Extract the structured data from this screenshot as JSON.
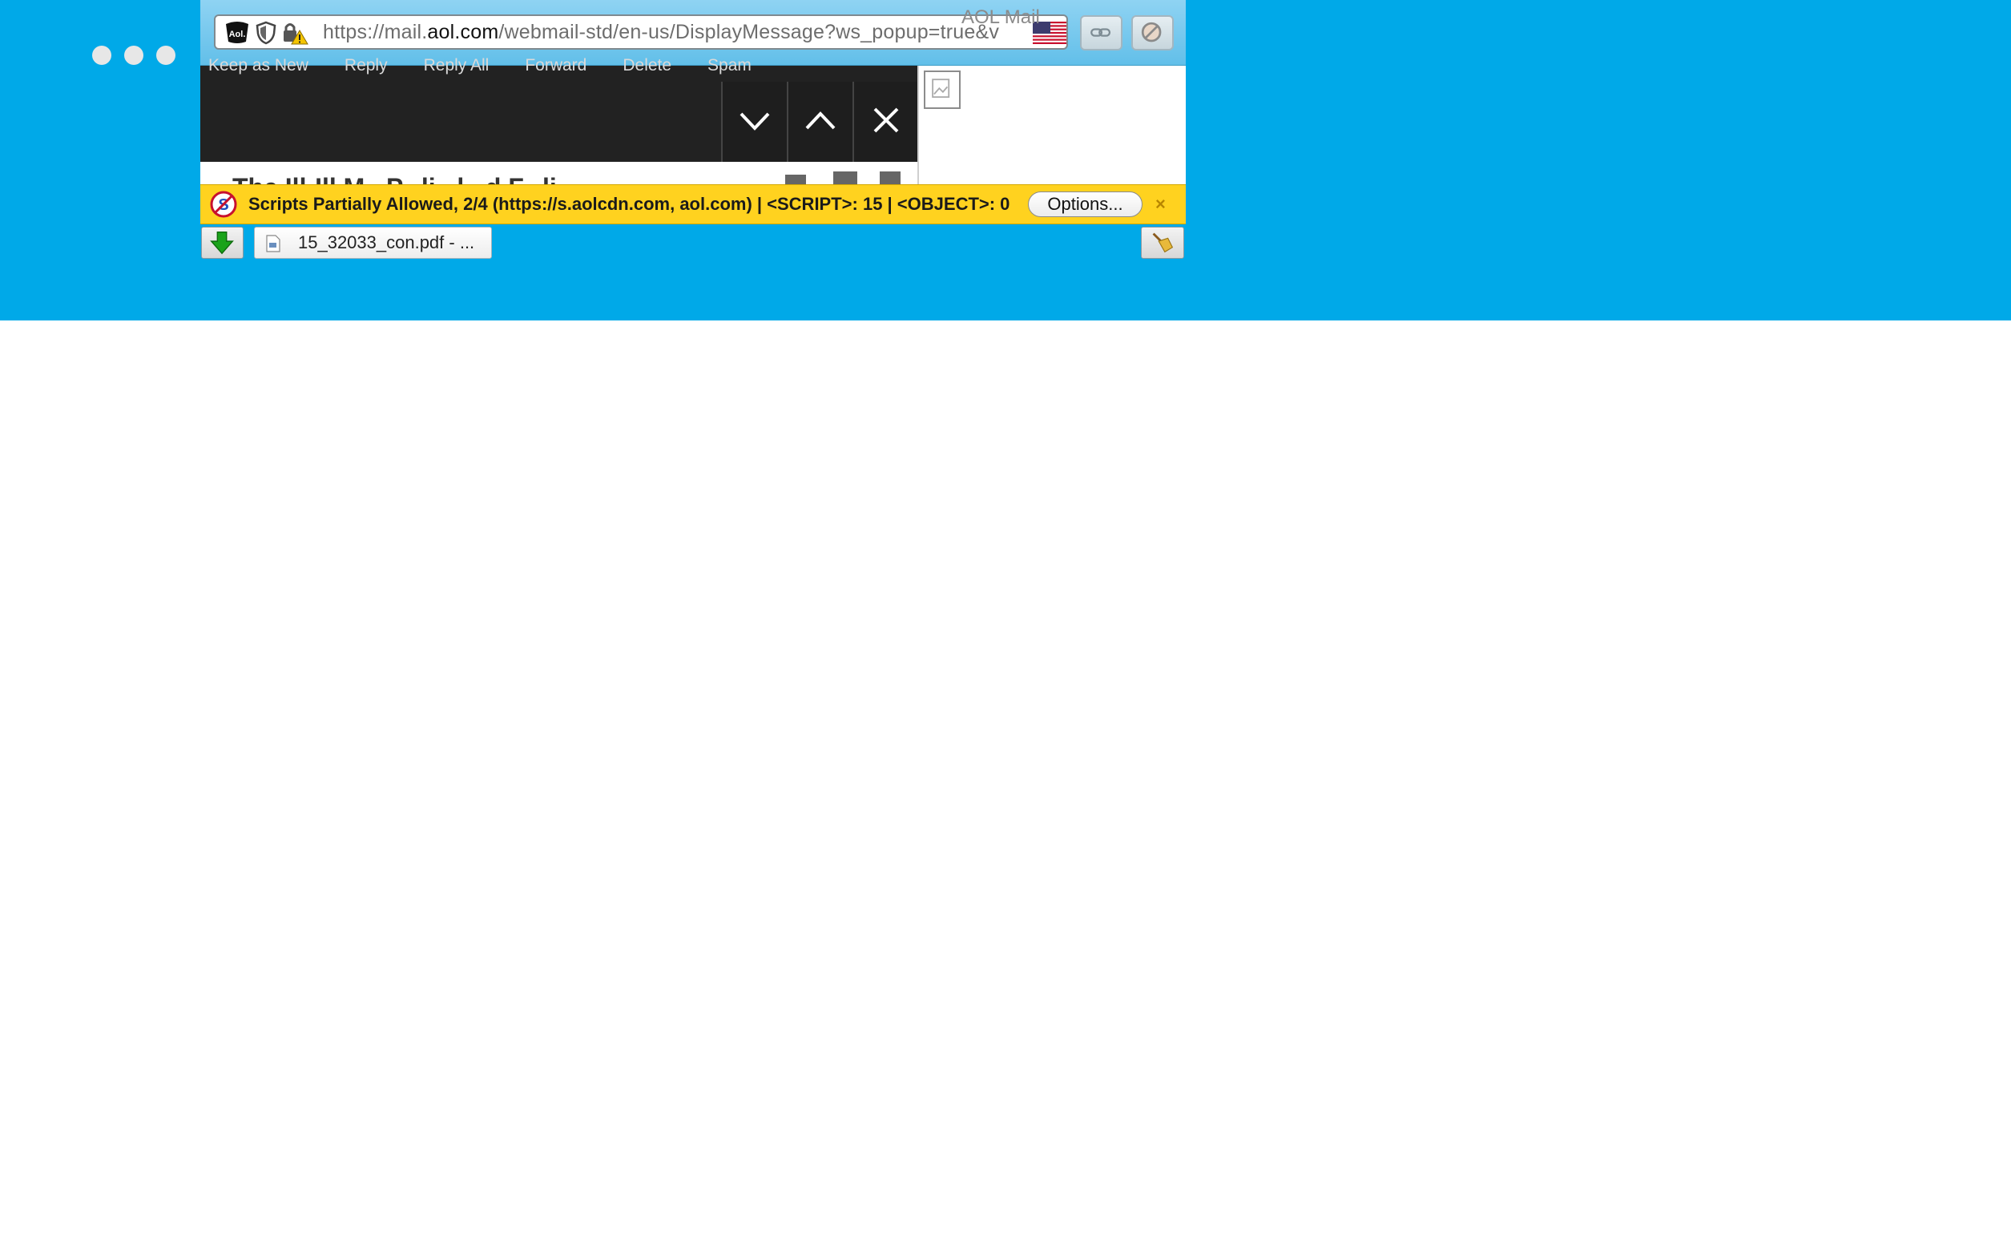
{
  "window": {
    "title": "AOL Mail",
    "controls": [
      "close",
      "minimize",
      "zoom"
    ]
  },
  "urlbar": {
    "url_prefix": "https://mail.",
    "url_domain": "aol.com",
    "url_rest": "/webmail-std/en-us/DisplayMessage?ws_popup=true&v",
    "site_icon": "aol-favicon-icon",
    "security_icons": [
      "shield-icon",
      "lock-warning-icon"
    ],
    "flag_icon": "us-flag-icon",
    "right_buttons": [
      "link-icon",
      "blocked-icon"
    ]
  },
  "message_toolbar": {
    "actions": [
      "Keep as New",
      "Reply",
      "Reply All",
      "Forward",
      "Delete",
      "Spam"
    ],
    "nav_icons": [
      "chevron-down-icon",
      "chevron-up-icon",
      "close-icon"
    ],
    "subject_partial": "The Ill-Ill M...P...li...l...d F...li..."
  },
  "noscript": {
    "message": "Scripts Partially Allowed, 2/4 (https://s.aolcdn.com, aol.com) | <SCRIPT>: 15 | <OBJECT>: 0",
    "options_label": "Options...",
    "close_label": "×"
  },
  "downloads": {
    "file_label": "15_32033_con.pdf - ...",
    "icons": [
      "download-arrow-icon",
      "pdf-file-icon",
      "broom-icon"
    ]
  },
  "colors": {
    "desktop": "#00a9e8",
    "noscript_bar": "#ffd21f",
    "toolbar_dark": "#222222"
  }
}
